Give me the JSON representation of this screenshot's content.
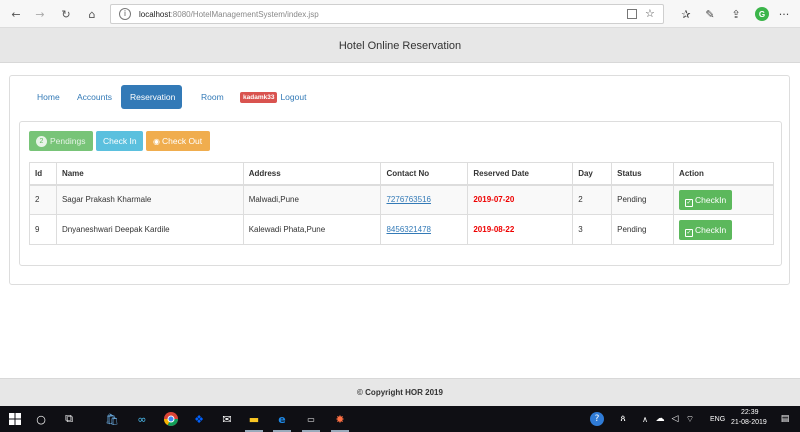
{
  "browser": {
    "url_host": "localhost",
    "url_rest": ":8080/HotelManagementSystem/index.jsp"
  },
  "header": {
    "title": "Hotel Online Reservation"
  },
  "nav": {
    "home": "Home",
    "accounts": "Accounts",
    "reservation": "Reservation",
    "room": "Room",
    "user_badge": "kadamk33",
    "logout": "Logout"
  },
  "actions": {
    "pending_count": "2",
    "pendings": "Pendings",
    "check_in": "Check In",
    "check_out": "Check Out"
  },
  "table": {
    "columns": [
      "Id",
      "Name",
      "Address",
      "Contact No",
      "Reserved Date",
      "Day",
      "Status",
      "Action"
    ],
    "rows": [
      {
        "id": "2",
        "name": "Sagar Prakash Kharmale",
        "address": "Malwadi,Pune",
        "contact": "7276763516",
        "date": "2019-07-20",
        "day": "2",
        "status": "Pending",
        "action": "CheckIn"
      },
      {
        "id": "9",
        "name": "Dnyaneshwari Deepak Kardile",
        "address": "Kalewadi Phata,Pune",
        "contact": "8456321478",
        "date": "2019-08-22",
        "day": "3",
        "status": "Pending",
        "action": "CheckIn"
      }
    ]
  },
  "footer": {
    "text": "© Copyright HOR 2019"
  },
  "taskbar": {
    "language": "ENG",
    "time": "22:39",
    "date": "21-08-2019"
  },
  "colors": {
    "primary": "#337ab7",
    "success": "#5cb85c",
    "info": "#5bc0de",
    "warning": "#f0ad4e",
    "danger": "#d9534f",
    "date_red": "#ee0000"
  }
}
